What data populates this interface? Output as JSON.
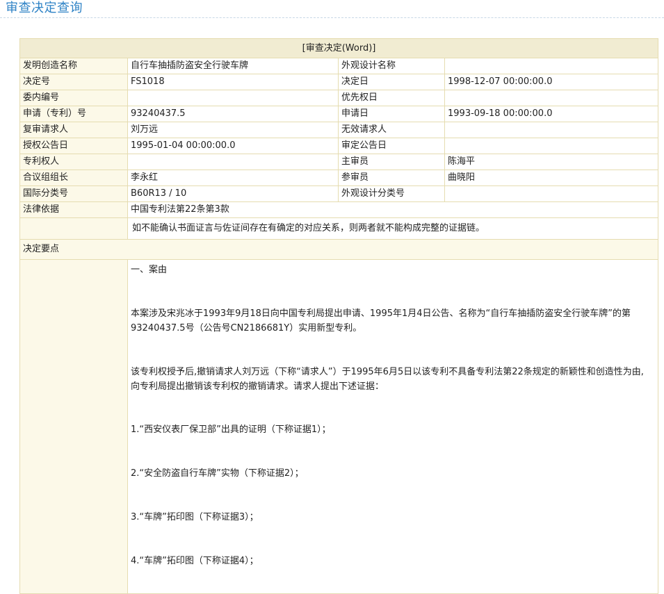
{
  "page": {
    "title": "审查决定查询"
  },
  "table": {
    "header_link": "[审查决定(Word)]",
    "rows": [
      {
        "label1": "发明创造名称",
        "value1": "自行车抽插防盗安全行驶车牌",
        "label2": "外观设计名称",
        "value2": ""
      },
      {
        "label1": "决定号",
        "value1": "FS1018",
        "label2": "决定日",
        "value2": "1998-12-07 00:00:00.0"
      },
      {
        "label1": "委内编号",
        "value1": "",
        "label2": "优先权日",
        "value2": ""
      },
      {
        "label1": "申请（专利）号",
        "value1": "93240437.5",
        "label2": "申请日",
        "value2": "1993-09-18 00:00:00.0"
      },
      {
        "label1": "复审请求人",
        "value1": "刘万远",
        "label2": "无效请求人",
        "value2": ""
      },
      {
        "label1": "授权公告日",
        "value1": "1995-01-04 00:00:00.0",
        "label2": "审定公告日",
        "value2": ""
      },
      {
        "label1": "专利权人",
        "value1": "",
        "label2": "主审员",
        "value2": "陈海平"
      },
      {
        "label1": "合议组组长",
        "value1": "李永红",
        "label2": "参审员",
        "value2": "曲晓阳"
      },
      {
        "label1": "国际分类号",
        "value1": "B60R13 / 10",
        "label2": "外观设计分类号",
        "value2": ""
      }
    ],
    "legal_basis_label": "法律依据",
    "legal_basis_value": "中国专利法第22条第3款",
    "summary": "如不能确认书面证言与佐证间存在有确定的对应关系，则两者就不能构成完整的证据链。",
    "points_label": "决定要点",
    "body": {
      "p1": "一、案由",
      "p2": "本案涉及宋兆冰于1993年9月18日向中国专利局提出申请、1995年1月4日公告、名称为“自行车抽插防盗安全行驶车牌”的第93240437.5号（公告号CN2186681Y）实用新型专利。",
      "p3": "该专利权授予后,撤销请求人刘万远（下称“请求人”）于1995年6月5日以该专利不具备专利法第22条规定的新颖性和创造性为由,向专利局提出撤销该专利权的撤销请求。请求人提出下述证据：",
      "p4": "1.“西安仪表厂保卫部”出具的证明（下称证据1）；",
      "p5": "2.“安全防盗自行车牌”实物（下称证据2）；",
      "p6": "3.“车牌”拓印图（下称证据3）；",
      "p7": "4.“车牌”拓印图（下称证据4）；"
    }
  }
}
